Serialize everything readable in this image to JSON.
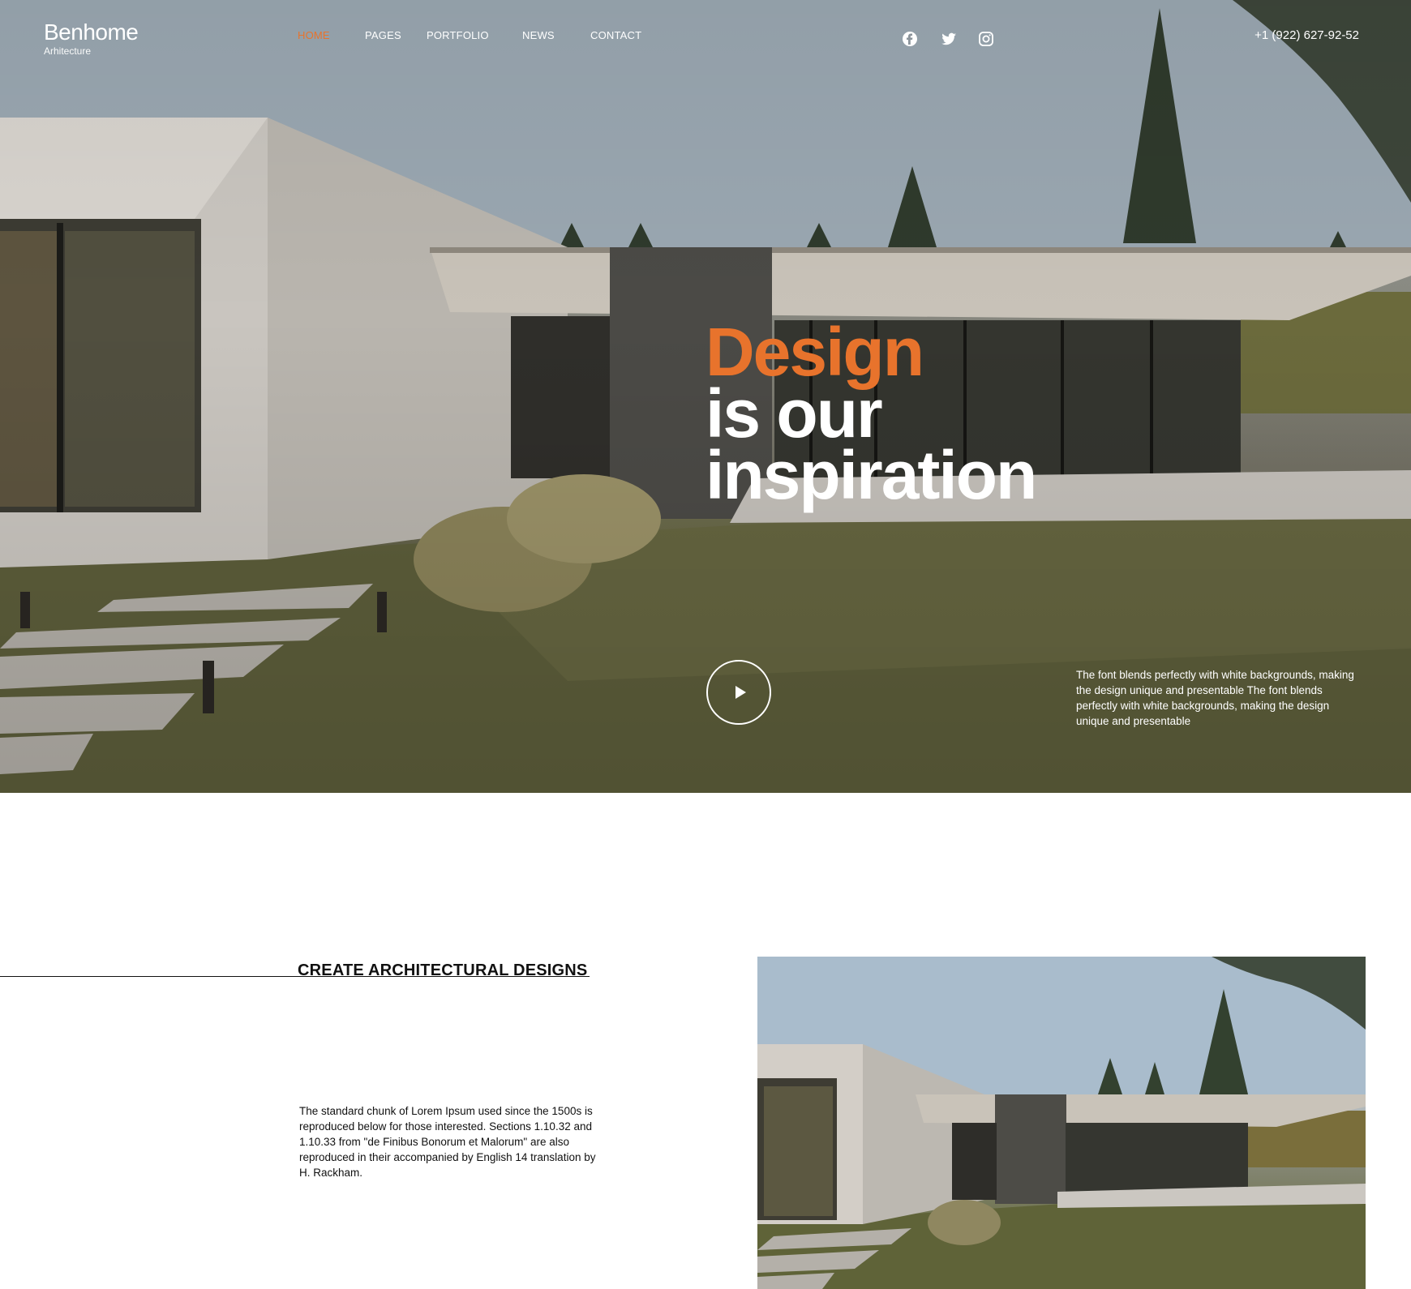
{
  "brand": {
    "title": "Benhome",
    "subtitle": "Arhitecture"
  },
  "nav": {
    "items": [
      {
        "label": "HOME",
        "active": true
      },
      {
        "label": "PAGES",
        "active": false
      },
      {
        "label": "PORTFOLIO",
        "active": false
      },
      {
        "label": "NEWS",
        "active": false
      },
      {
        "label": "CONTACT",
        "active": false
      }
    ]
  },
  "socials": [
    "facebook-icon",
    "twitter-icon",
    "instagram-icon"
  ],
  "phone": "+1 (922) 627-92-52",
  "hero": {
    "line1": "Design",
    "line2": "is our",
    "line3": "inspiration",
    "description": "The font blends perfectly with white backgrounds, making the design unique and presentable The font blends perfectly with white backgrounds, making the design unique and presentable",
    "play_icon": "play-icon"
  },
  "section": {
    "title": "CREATE ARCHITECTURAL DESIGNS",
    "body": "The standard chunk of Lorem Ipsum used since the 1500s is reproduced below for those interested. Sections 1.10.32 and 1.10.33 from \"de Finibus Bonorum et Malorum\"  are also reproduced in their  accompanied by English 14 translation by H. Rackham."
  },
  "colors": {
    "accent": "#e8732c",
    "text": "#111111",
    "white": "#ffffff"
  }
}
